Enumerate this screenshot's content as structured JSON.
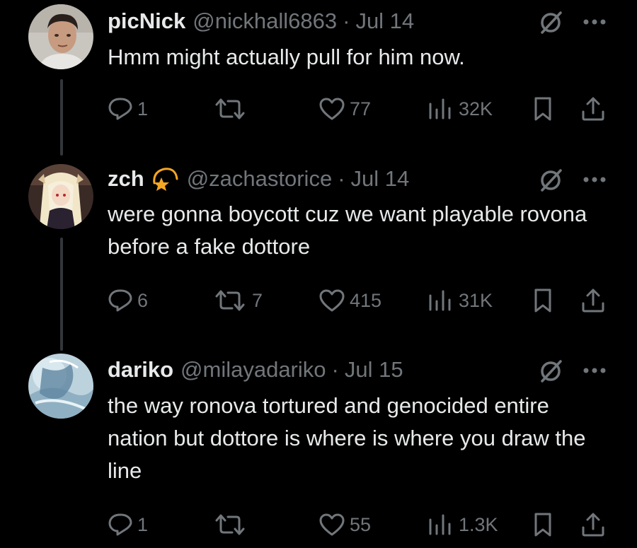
{
  "tweets": [
    {
      "display_name": "picNick",
      "handle": "@nickhall6863",
      "separator": "·",
      "date": "Jul 14",
      "text": "Hmm might actually pull for him now.",
      "replies": "1",
      "reposts": "",
      "likes": "77",
      "views": "32K"
    },
    {
      "display_name": "zch",
      "handle": "@zachastorice",
      "separator": "·",
      "date": "Jul 14",
      "text": "were gonna boycott cuz we want playable rovona before a fake dottore",
      "replies": "6",
      "reposts": "7",
      "likes": "415",
      "views": "31K"
    },
    {
      "display_name": "dariko",
      "handle": "@milayadariko",
      "separator": "·",
      "date": "Jul 15",
      "text": "the way ronova tortured and genocided entire nation but dottore is where is where you draw the line",
      "replies": "1",
      "reposts": "",
      "likes": "55",
      "views": "1.3K"
    }
  ],
  "icons": {
    "reply": "reply-bubble-icon",
    "repost": "repost-icon",
    "like": "heart-icon",
    "views": "views-bar-icon",
    "bookmark": "bookmark-icon",
    "share": "share-icon",
    "grok": "grok-slash-icon",
    "more": "more-dots-icon",
    "badge": "star-moon-icon"
  },
  "colors": {
    "background": "#000000",
    "text": "#e7e9ea",
    "muted": "#71767b",
    "badge": "#f5a623"
  }
}
